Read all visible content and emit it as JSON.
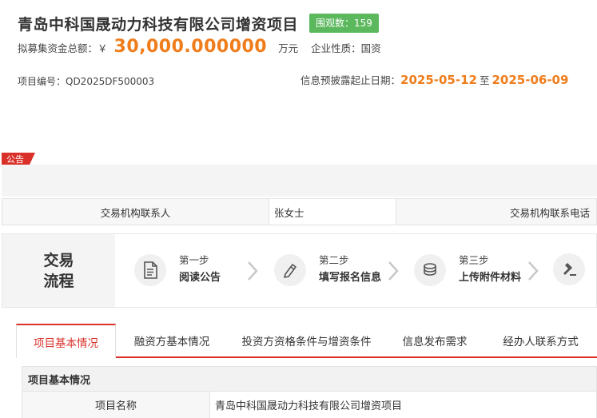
{
  "header": {
    "title": "青岛中科国晟动力科技有限公司增资项目",
    "views_badge": "围观数：159",
    "funds_label": "拟募集资金总额：￥",
    "funds_value": "30,000.000000",
    "funds_unit": "万元",
    "nature_label": "企业性质：国资",
    "project_code_label": "项目编号：QD2025DF500003",
    "disclosure_label": "信息预披露起止日期：",
    "date_start": "2025-05-12",
    "date_to": "至",
    "date_end": "2025-06-09"
  },
  "notice": {
    "tag": "公告"
  },
  "contact": {
    "contact_label": "交易机构联系人",
    "contact_value": "张女士",
    "phone_label": "交易机构联系电话"
  },
  "process": {
    "label_line1": "交易",
    "label_line2": "流程",
    "steps": [
      {
        "num": "第一步",
        "title": "阅读公告",
        "icon": "document-icon"
      },
      {
        "num": "第二步",
        "title": "填写报名信息",
        "icon": "edit-icon"
      },
      {
        "num": "第三步",
        "title": "上传附件材料",
        "icon": "coins-icon"
      },
      {
        "num": "",
        "title": "",
        "icon": "gavel-icon"
      }
    ]
  },
  "tabs": [
    {
      "label": "项目基本情况",
      "active": true
    },
    {
      "label": "融资方基本情况",
      "active": false
    },
    {
      "label": "投资方资格条件与增资条件",
      "active": false
    },
    {
      "label": "信息发布需求",
      "active": false
    },
    {
      "label": "经办人联系方式",
      "active": false
    }
  ],
  "info": {
    "section_title": "项目基本情况",
    "rows": [
      {
        "key": "项目名称",
        "value": "青岛中科国晟动力科技有限公司增资项目"
      }
    ]
  },
  "colors": {
    "accent_red": "#d9312a",
    "accent_orange": "#ef7d1c",
    "badge_green": "#5bb85d"
  }
}
